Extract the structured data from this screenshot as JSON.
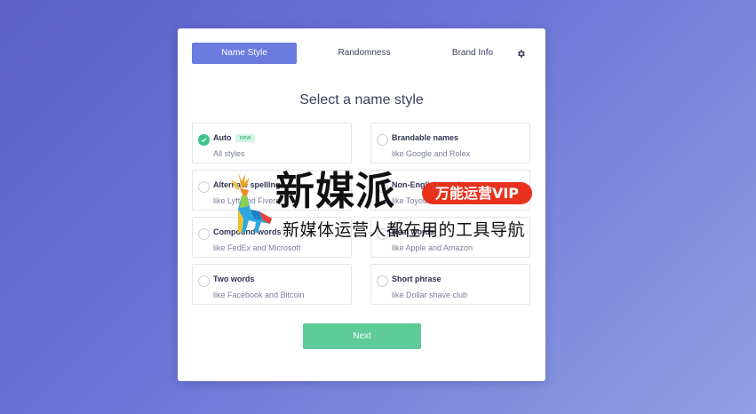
{
  "tabs": [
    {
      "label": "Name Style",
      "active": true
    },
    {
      "label": "Randomness",
      "active": false
    },
    {
      "label": "Brand Info",
      "active": false
    }
  ],
  "settings_icon": "gear-icon",
  "heading": "Select a name style",
  "options": [
    {
      "title": "Auto",
      "badge": "new",
      "subtitle": "All styles",
      "selected": true
    },
    {
      "title": "Brandable names",
      "subtitle": "like Google and Rolex",
      "selected": false
    },
    {
      "title": "Alternate spelling",
      "subtitle": "like Lyft and Fiverr",
      "selected": false
    },
    {
      "title": "Non-English words",
      "subtitle": "like Toyota and Audi",
      "selected": false
    },
    {
      "title": "Compound words",
      "subtitle": "like FedEx and Microsoft",
      "selected": false
    },
    {
      "title": "Real words",
      "subtitle": "like Apple and Amazon",
      "selected": false
    },
    {
      "title": "Two words",
      "subtitle": "like Facebook and Bitcoin",
      "selected": false
    },
    {
      "title": "Short phrase",
      "subtitle": "like Dollar shave club",
      "selected": false
    }
  ],
  "next_label": "Next",
  "watermark": {
    "brand": "新媒派",
    "pill": "万能运营VIP",
    "tagline": "新媒体运营人都在用的工具导航"
  },
  "colors": {
    "accent": "#6c7be0",
    "success": "#5ecb98",
    "badge_bg": "#d3f5e4"
  }
}
